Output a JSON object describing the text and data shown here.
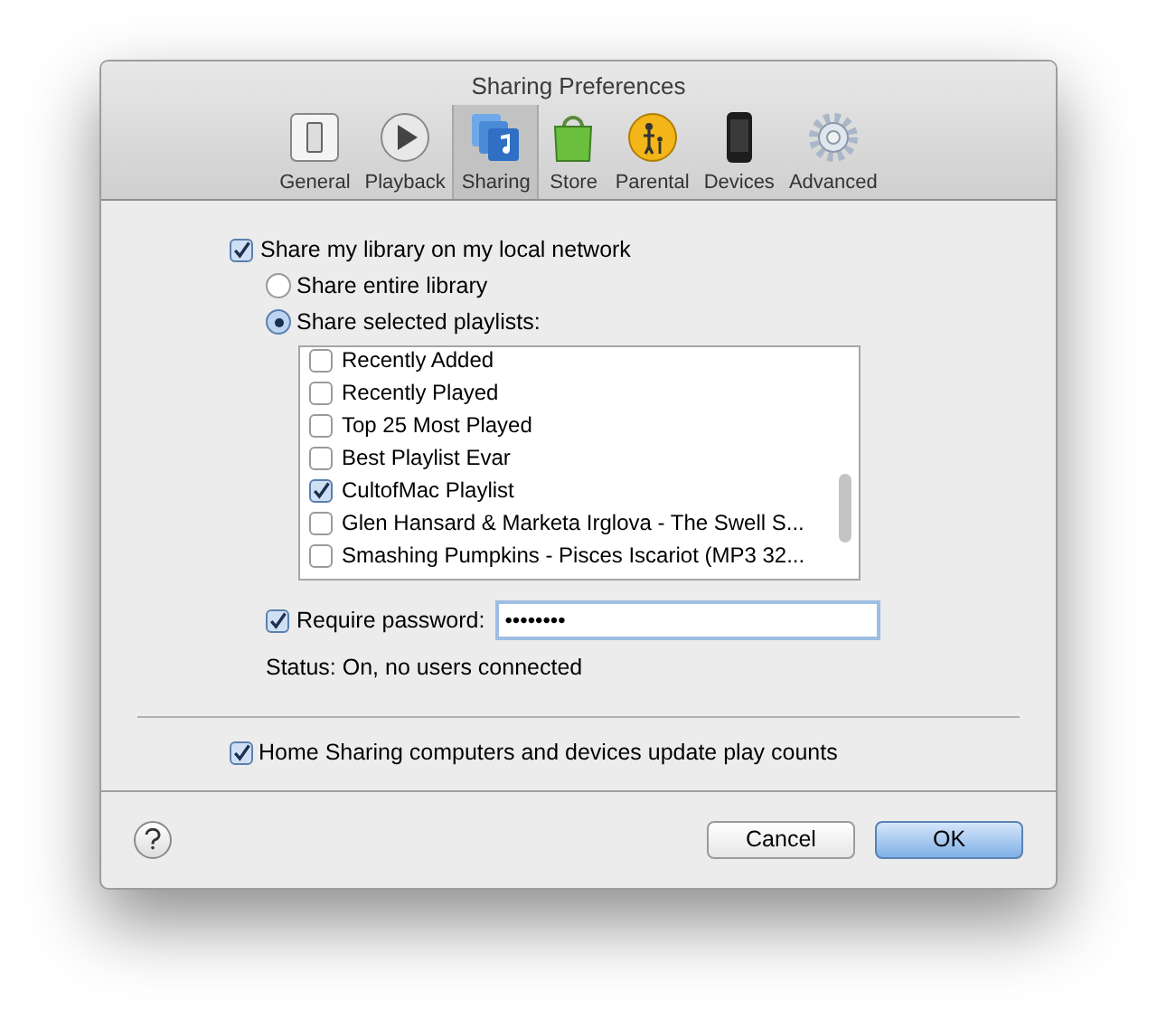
{
  "window": {
    "title": "Sharing Preferences"
  },
  "tabs": [
    {
      "label": "General",
      "kind": "switch",
      "selected": false
    },
    {
      "label": "Playback",
      "kind": "play",
      "selected": false
    },
    {
      "label": "Sharing",
      "kind": "sharing",
      "selected": true
    },
    {
      "label": "Store",
      "kind": "bag",
      "selected": false
    },
    {
      "label": "Parental",
      "kind": "parental",
      "selected": false
    },
    {
      "label": "Devices",
      "kind": "phone",
      "selected": false
    },
    {
      "label": "Advanced",
      "kind": "gear",
      "selected": false
    }
  ],
  "share_library": {
    "label": "Share my library on my local network",
    "checked": true
  },
  "share_options": [
    {
      "label": "Share entire library",
      "selected": false
    },
    {
      "label": "Share selected playlists:",
      "selected": true
    }
  ],
  "playlists": [
    {
      "label": "Recently Added",
      "checked": false
    },
    {
      "label": "Recently Played",
      "checked": false
    },
    {
      "label": "Top 25 Most Played",
      "checked": false
    },
    {
      "label": "Best Playlist Evar",
      "checked": false
    },
    {
      "label": "CultofMac Playlist",
      "checked": true
    },
    {
      "label": "Glen Hansard & Marketa Irglova - The Swell S...",
      "checked": false
    },
    {
      "label": "Smashing Pumpkins - Pisces Iscariot (MP3 32...",
      "checked": false
    }
  ],
  "require_password": {
    "label": "Require password:",
    "checked": true,
    "value": "••••••••"
  },
  "status": "Status: On, no users connected",
  "update_play_counts": {
    "label": "Home Sharing computers and devices update play counts",
    "checked": true
  },
  "buttons": [
    {
      "label": "Cancel",
      "kind": "cancel"
    },
    {
      "label": "OK",
      "kind": "default"
    }
  ]
}
